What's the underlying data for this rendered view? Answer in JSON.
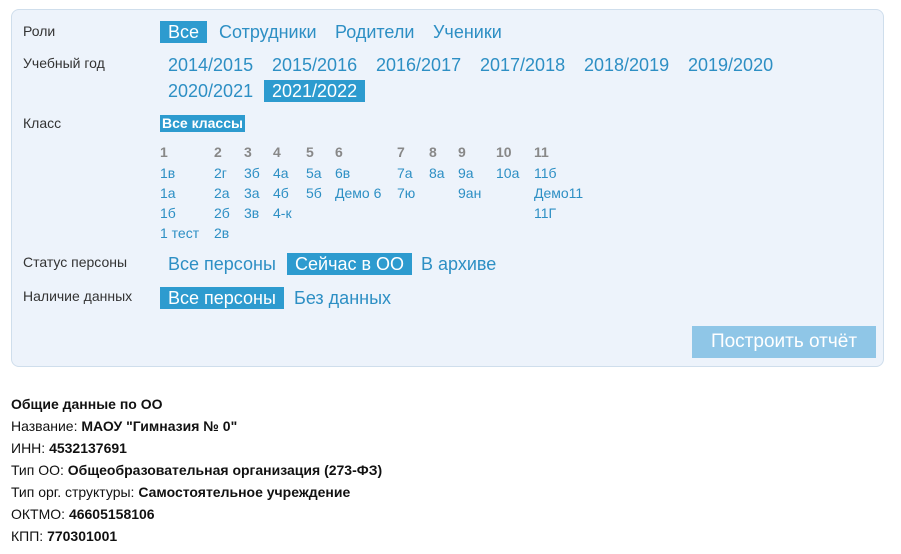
{
  "filters": {
    "roles": {
      "label": "Роли",
      "options": [
        "Все",
        "Сотрудники",
        "Родители",
        "Ученики"
      ],
      "selected": "Все"
    },
    "year": {
      "label": "Учебный год",
      "options": [
        "2014/2015",
        "2015/2016",
        "2016/2017",
        "2017/2018",
        "2018/2019",
        "2019/2020",
        "2020/2021",
        "2021/2022"
      ],
      "selected": "2021/2022"
    },
    "class": {
      "label": "Класс",
      "all_label": "Все классы",
      "groups": [
        {
          "grade": "1",
          "items": [
            "1в",
            "1а",
            "1б",
            "1 тест"
          ]
        },
        {
          "grade": "2",
          "items": [
            "2г",
            "2а",
            "2б",
            "2в"
          ]
        },
        {
          "grade": "3",
          "items": [
            "3б",
            "3а",
            "3в"
          ]
        },
        {
          "grade": "4",
          "items": [
            "4а",
            "4б",
            "4-к"
          ]
        },
        {
          "grade": "5",
          "items": [
            "5а",
            "5б"
          ]
        },
        {
          "grade": "6",
          "items": [
            "6в",
            "Демо 6"
          ]
        },
        {
          "grade": "7",
          "items": [
            "7а",
            "7ю"
          ]
        },
        {
          "grade": "8",
          "items": [
            "8а"
          ]
        },
        {
          "grade": "9",
          "items": [
            "9а",
            "9ан"
          ]
        },
        {
          "grade": "10",
          "items": [
            "10а"
          ]
        },
        {
          "grade": "11",
          "items": [
            "11б",
            "Демо11",
            "11Г"
          ]
        }
      ]
    },
    "status": {
      "label": "Статус персоны",
      "options": [
        "Все персоны",
        "Сейчас в ОО",
        "В архиве"
      ],
      "selected": "Сейчас в ОО"
    },
    "data_presence": {
      "label": "Наличие данных",
      "options": [
        "Все персоны",
        "Без данных"
      ],
      "selected": "Все персоны"
    },
    "build_button": "Построить отчёт"
  },
  "info": {
    "title": "Общие данные по ОО",
    "rows": [
      {
        "label": "Название:",
        "value": "МАОУ \"Гимназия № 0\""
      },
      {
        "label": "ИНН:",
        "value": "4532137691"
      },
      {
        "label": "Тип ОО:",
        "value": "Общеобразовательная организация (273-ФЗ)"
      },
      {
        "label": "Тип орг. структуры:",
        "value": "Самостоятельное учреждение"
      },
      {
        "label": "ОКТМО:",
        "value": "46605158106"
      },
      {
        "label": "КПП:",
        "value": "770301001"
      }
    ]
  }
}
